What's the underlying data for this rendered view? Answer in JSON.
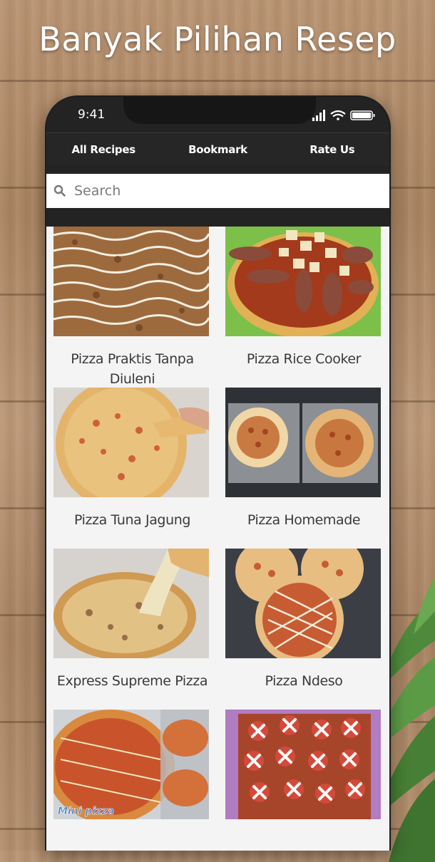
{
  "headline": "Banyak Pilihan Resep",
  "status_bar": {
    "time": "9:41"
  },
  "tabs": [
    {
      "label": "All Recipes",
      "active": true
    },
    {
      "label": "Bookmark",
      "active": false
    },
    {
      "label": "Rate Us",
      "active": false
    }
  ],
  "search": {
    "placeholder": "Search",
    "value": ""
  },
  "recipes": [
    {
      "title": "Pizza Praktis Tanpa Diuleni",
      "image": "pizza-mayo-drizzle"
    },
    {
      "title": "Pizza Rice Cooker",
      "image": "pizza-sausage-cheese"
    },
    {
      "title": "Pizza Tuna Jagung",
      "image": "pizza-slice-hand"
    },
    {
      "title": "Pizza Homemade",
      "image": "pizza-trays-crust"
    },
    {
      "title": "Express Supreme Pizza",
      "image": "pizza-cheese-pull"
    },
    {
      "title": "Pizza Ndeso",
      "image": "pizza-three-sausage"
    },
    {
      "title": "",
      "image": "mini-pizza-packaged",
      "image_text": "Mini pizza"
    },
    {
      "title": "",
      "image": "pizza-sausage-cross"
    }
  ],
  "colors": {
    "tab_bar": "#262626",
    "tab_active": "#3b3b3b",
    "grid_bg": "#f4f4f4",
    "title_text": "#3a3a3a"
  }
}
